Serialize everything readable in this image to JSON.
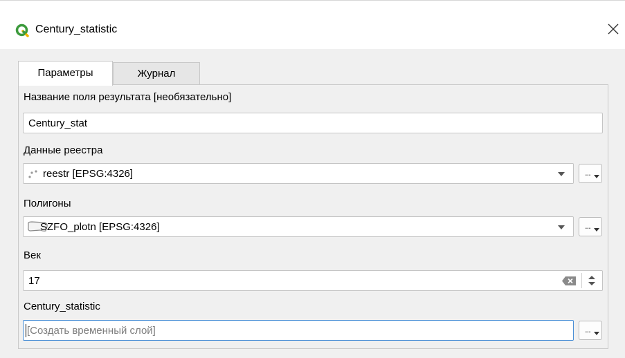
{
  "window": {
    "title": "Century_statistic",
    "icon": "qgis-logo-icon",
    "close_icon": "close-icon",
    "accent": "#3c9a3c"
  },
  "tabs": [
    {
      "label": "Параметры",
      "active": true
    },
    {
      "label": "Журнал",
      "active": false
    }
  ],
  "params": {
    "result_field": {
      "label": "Название поля результата [необязательно]",
      "value": "Century_stat"
    },
    "registry": {
      "label": "Данные реестра",
      "value": "reestr [EPSG:4326]",
      "icon": "point-layer-icon"
    },
    "polygons": {
      "label": "Полигоны",
      "value": "SZFO_plotn [EPSG:4326]",
      "icon": "polygon-layer-icon"
    },
    "century": {
      "label": "Век",
      "value": "17"
    },
    "output": {
      "label": "Century_statistic",
      "placeholder": "[Создать временный слой]"
    }
  },
  "browse_label": "..."
}
